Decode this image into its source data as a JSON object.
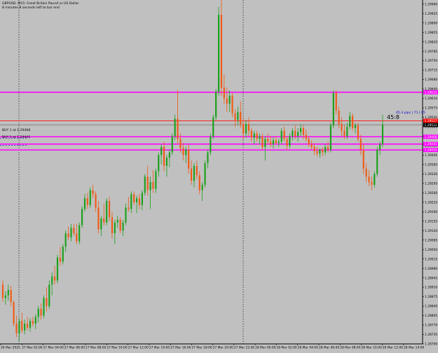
{
  "header": {
    "title_line": "GBPUSD, M15:  Great Britain Pound vs US Dollar",
    "status_line": "8 minutes 8 seconds left to bar end"
  },
  "colors": {
    "background": "#c0c0c0",
    "bull": "#1aa01a",
    "bear": "#f05a14",
    "magenta": "#ff00ff",
    "red_line": "#ff2020",
    "blue_text": "#0000c8",
    "grid": "#000000",
    "current_price_bg": "#ff0000",
    "price_tag_bg": "#000000"
  },
  "price_axis": {
    "labels": [
      "1.29960",
      "1.29925",
      "1.29890",
      "1.29855",
      "1.29820",
      "1.29785",
      "1.29750",
      "1.29715",
      "1.29680",
      "1.29645",
      "1.29610",
      "1.29575",
      "1.29540",
      "1.29505",
      "1.29470",
      "1.29435",
      "1.29400",
      "1.29365",
      "1.29330",
      "1.29295",
      "1.29260",
      "1.29225",
      "1.29190",
      "1.29155",
      "1.29120",
      "1.29085",
      "1.29050",
      "1.29015",
      "1.28980",
      "1.28945",
      "1.28910",
      "1.28875",
      "1.28840",
      "1.28805",
      "1.28770",
      "1.28735",
      "1.28700"
    ],
    "tags": [
      {
        "price": 1.29633,
        "text": "1.29633",
        "bg": "#ff00ff",
        "fg": "#ffffff"
      },
      {
        "price": 1.29527,
        "text": "1.29527",
        "bg": "#ff0000",
        "fg": "#ffffff"
      },
      {
        "price": 1.29512,
        "text": "1.29512",
        "bg": "#000000",
        "fg": "#ffffff"
      },
      {
        "price": 1.29468,
        "text": "1.29468",
        "bg": "#ff00ff",
        "fg": "#ffffff"
      },
      {
        "price": 1.29441,
        "text": "1.29441",
        "bg": "#ff00ff",
        "fg": "#ffffff"
      },
      {
        "price": 1.29419,
        "text": "1.29419",
        "bg": "#ff00ff",
        "fg": "#ffffff"
      }
    ]
  },
  "time_axis": {
    "labels": [
      "26 Mar 2025",
      "27 Mar 02:00",
      "27 Mar 04:00",
      "27 Mar 06:00",
      "27 Mar 08:00",
      "27 Mar 10:00",
      "27 Mar 12:00",
      "27 Mar 14:00",
      "27 Mar 16:00",
      "27 Mar 18:00",
      "27 Mar 20:00",
      "27 Mar 22:00",
      "28 Mar 00:00",
      "28 Mar 02:00",
      "28 Mar 04:00",
      "28 Mar 06:00",
      "28 Mar 08:00",
      "28 Mar 10:00",
      "28 Mar 12:00",
      "28 Mar 14:00"
    ]
  },
  "annotations": {
    "countdown": "45:8",
    "pips_label": "45.3 pips | 71 | 05",
    "buy_line_1": "BUY 1 at 1.29468",
    "buy_line_2": "BUY 1 at 1.29441"
  },
  "levels": {
    "magenta": [
      1.29633,
      1.29468,
      1.29441,
      1.29419
    ],
    "red": [
      1.29527
    ],
    "gray": [
      1.29512
    ]
  },
  "chart_data": {
    "type": "candlestick",
    "symbol": "GBPUSD",
    "timeframe": "M15",
    "ylim": [
      1.287,
      1.29975
    ],
    "grid": false,
    "candles": [
      {
        "o": 1.2892,
        "h": 1.28935,
        "l": 1.28855,
        "c": 1.2887
      },
      {
        "o": 1.2887,
        "h": 1.28895,
        "l": 1.28845,
        "c": 1.2888
      },
      {
        "o": 1.2888,
        "h": 1.2892,
        "l": 1.2886,
        "c": 1.289
      },
      {
        "o": 1.289,
        "h": 1.28915,
        "l": 1.2884,
        "c": 1.28855
      },
      {
        "o": 1.28855,
        "h": 1.2886,
        "l": 1.28765,
        "c": 1.28775
      },
      {
        "o": 1.28775,
        "h": 1.28805,
        "l": 1.28725,
        "c": 1.2874
      },
      {
        "o": 1.2874,
        "h": 1.28795,
        "l": 1.2871,
        "c": 1.28785
      },
      {
        "o": 1.28785,
        "h": 1.28815,
        "l": 1.2874,
        "c": 1.2875
      },
      {
        "o": 1.2875,
        "h": 1.2879,
        "l": 1.28735,
        "c": 1.28775
      },
      {
        "o": 1.28775,
        "h": 1.288,
        "l": 1.2875,
        "c": 1.2876
      },
      {
        "o": 1.2876,
        "h": 1.28795,
        "l": 1.28745,
        "c": 1.28785
      },
      {
        "o": 1.28785,
        "h": 1.288,
        "l": 1.28765,
        "c": 1.28775
      },
      {
        "o": 1.28775,
        "h": 1.2881,
        "l": 1.28755,
        "c": 1.288
      },
      {
        "o": 1.288,
        "h": 1.2884,
        "l": 1.2878,
        "c": 1.2883
      },
      {
        "o": 1.2883,
        "h": 1.2885,
        "l": 1.2879,
        "c": 1.28805
      },
      {
        "o": 1.28805,
        "h": 1.2888,
        "l": 1.28795,
        "c": 1.2887
      },
      {
        "o": 1.2887,
        "h": 1.2891,
        "l": 1.2882,
        "c": 1.2884
      },
      {
        "o": 1.2884,
        "h": 1.28935,
        "l": 1.2883,
        "c": 1.2892
      },
      {
        "o": 1.2892,
        "h": 1.28965,
        "l": 1.2888,
        "c": 1.2895
      },
      {
        "o": 1.2895,
        "h": 1.2899,
        "l": 1.2892,
        "c": 1.28935
      },
      {
        "o": 1.28935,
        "h": 1.2903,
        "l": 1.28925,
        "c": 1.2902
      },
      {
        "o": 1.2902,
        "h": 1.2906,
        "l": 1.2899,
        "c": 1.29005
      },
      {
        "o": 1.29005,
        "h": 1.2907,
        "l": 1.28995,
        "c": 1.2906
      },
      {
        "o": 1.2906,
        "h": 1.2912,
        "l": 1.2904,
        "c": 1.2911
      },
      {
        "o": 1.2911,
        "h": 1.29135,
        "l": 1.29085,
        "c": 1.29095
      },
      {
        "o": 1.29095,
        "h": 1.29145,
        "l": 1.2908,
        "c": 1.2913
      },
      {
        "o": 1.2913,
        "h": 1.29145,
        "l": 1.291,
        "c": 1.2911
      },
      {
        "o": 1.2911,
        "h": 1.29145,
        "l": 1.2907,
        "c": 1.2908
      },
      {
        "o": 1.2908,
        "h": 1.2915,
        "l": 1.2907,
        "c": 1.2914
      },
      {
        "o": 1.2914,
        "h": 1.2921,
        "l": 1.2913,
        "c": 1.292
      },
      {
        "o": 1.292,
        "h": 1.29255,
        "l": 1.2919,
        "c": 1.2924
      },
      {
        "o": 1.2924,
        "h": 1.2926,
        "l": 1.292,
        "c": 1.29215
      },
      {
        "o": 1.29215,
        "h": 1.2928,
        "l": 1.29205,
        "c": 1.2927
      },
      {
        "o": 1.2927,
        "h": 1.2929,
        "l": 1.2924,
        "c": 1.29255
      },
      {
        "o": 1.29255,
        "h": 1.29265,
        "l": 1.2919,
        "c": 1.29205
      },
      {
        "o": 1.29205,
        "h": 1.2923,
        "l": 1.2911,
        "c": 1.29125
      },
      {
        "o": 1.29125,
        "h": 1.29175,
        "l": 1.291,
        "c": 1.29165
      },
      {
        "o": 1.29165,
        "h": 1.2922,
        "l": 1.2914,
        "c": 1.2915
      },
      {
        "o": 1.2915,
        "h": 1.2924,
        "l": 1.2914,
        "c": 1.2923
      },
      {
        "o": 1.2923,
        "h": 1.29245,
        "l": 1.29155,
        "c": 1.2917
      },
      {
        "o": 1.2917,
        "h": 1.2919,
        "l": 1.2909,
        "c": 1.2911
      },
      {
        "o": 1.2911,
        "h": 1.2916,
        "l": 1.2907,
        "c": 1.2915
      },
      {
        "o": 1.2915,
        "h": 1.29175,
        "l": 1.2913,
        "c": 1.2916
      },
      {
        "o": 1.2916,
        "h": 1.2917,
        "l": 1.2911,
        "c": 1.2912
      },
      {
        "o": 1.2912,
        "h": 1.2916,
        "l": 1.291,
        "c": 1.2915
      },
      {
        "o": 1.2915,
        "h": 1.2922,
        "l": 1.2914,
        "c": 1.29205
      },
      {
        "o": 1.29205,
        "h": 1.29245,
        "l": 1.2919,
        "c": 1.292
      },
      {
        "o": 1.292,
        "h": 1.29265,
        "l": 1.29185,
        "c": 1.29255
      },
      {
        "o": 1.29255,
        "h": 1.29265,
        "l": 1.29215,
        "c": 1.29225
      },
      {
        "o": 1.29225,
        "h": 1.2925,
        "l": 1.29185,
        "c": 1.2924
      },
      {
        "o": 1.2924,
        "h": 1.29255,
        "l": 1.292,
        "c": 1.29215
      },
      {
        "o": 1.29215,
        "h": 1.2927,
        "l": 1.29195,
        "c": 1.2926
      },
      {
        "o": 1.2926,
        "h": 1.2933,
        "l": 1.2925,
        "c": 1.2932
      },
      {
        "o": 1.2932,
        "h": 1.2936,
        "l": 1.2925,
        "c": 1.2927
      },
      {
        "o": 1.2927,
        "h": 1.2932,
        "l": 1.292,
        "c": 1.293
      },
      {
        "o": 1.293,
        "h": 1.29345,
        "l": 1.2926,
        "c": 1.29275
      },
      {
        "o": 1.29275,
        "h": 1.2935,
        "l": 1.2926,
        "c": 1.2934
      },
      {
        "o": 1.2934,
        "h": 1.2941,
        "l": 1.2932,
        "c": 1.294
      },
      {
        "o": 1.294,
        "h": 1.2944,
        "l": 1.29365,
        "c": 1.2943
      },
      {
        "o": 1.2943,
        "h": 1.2945,
        "l": 1.2934,
        "c": 1.2936
      },
      {
        "o": 1.2936,
        "h": 1.294,
        "l": 1.2932,
        "c": 1.2939
      },
      {
        "o": 1.2939,
        "h": 1.2942,
        "l": 1.29355,
        "c": 1.2941
      },
      {
        "o": 1.2941,
        "h": 1.2948,
        "l": 1.294,
        "c": 1.2947
      },
      {
        "o": 1.2947,
        "h": 1.2955,
        "l": 1.29455,
        "c": 1.29535
      },
      {
        "o": 1.29535,
        "h": 1.2964,
        "l": 1.2944,
        "c": 1.2946
      },
      {
        "o": 1.2946,
        "h": 1.2948,
        "l": 1.2941,
        "c": 1.29425
      },
      {
        "o": 1.29425,
        "h": 1.29445,
        "l": 1.2938,
        "c": 1.294
      },
      {
        "o": 1.294,
        "h": 1.2943,
        "l": 1.2937,
        "c": 1.2942
      },
      {
        "o": 1.2942,
        "h": 1.2944,
        "l": 1.2933,
        "c": 1.2935
      },
      {
        "o": 1.2935,
        "h": 1.2938,
        "l": 1.2929,
        "c": 1.29305
      },
      {
        "o": 1.29305,
        "h": 1.2937,
        "l": 1.2928,
        "c": 1.2936
      },
      {
        "o": 1.2936,
        "h": 1.2938,
        "l": 1.2931,
        "c": 1.29325
      },
      {
        "o": 1.29325,
        "h": 1.2934,
        "l": 1.29255,
        "c": 1.2927
      },
      {
        "o": 1.2927,
        "h": 1.293,
        "l": 1.2923,
        "c": 1.2929
      },
      {
        "o": 1.2929,
        "h": 1.2938,
        "l": 1.2928,
        "c": 1.2937
      },
      {
        "o": 1.2937,
        "h": 1.2942,
        "l": 1.2935,
        "c": 1.2941
      },
      {
        "o": 1.2941,
        "h": 1.2948,
        "l": 1.294,
        "c": 1.2947
      },
      {
        "o": 1.2947,
        "h": 1.2955,
        "l": 1.2946,
        "c": 1.2954
      },
      {
        "o": 1.2954,
        "h": 1.29645,
        "l": 1.2953,
        "c": 1.29635
      },
      {
        "o": 1.29635,
        "h": 1.2995,
        "l": 1.2962,
        "c": 1.2992
      },
      {
        "o": 1.2992,
        "h": 1.29975,
        "l": 1.2962,
        "c": 1.2965
      },
      {
        "o": 1.2965,
        "h": 1.297,
        "l": 1.2959,
        "c": 1.2961
      },
      {
        "o": 1.2961,
        "h": 1.2965,
        "l": 1.2956,
        "c": 1.2959
      },
      {
        "o": 1.2959,
        "h": 1.2964,
        "l": 1.2956,
        "c": 1.2962
      },
      {
        "o": 1.2962,
        "h": 1.2963,
        "l": 1.2954,
        "c": 1.29555
      },
      {
        "o": 1.29555,
        "h": 1.2957,
        "l": 1.29505,
        "c": 1.2953
      },
      {
        "o": 1.2953,
        "h": 1.2958,
        "l": 1.2951,
        "c": 1.2956
      },
      {
        "o": 1.2956,
        "h": 1.296,
        "l": 1.295,
        "c": 1.29515
      },
      {
        "o": 1.29515,
        "h": 1.29535,
        "l": 1.2946,
        "c": 1.2948
      },
      {
        "o": 1.2948,
        "h": 1.2953,
        "l": 1.29465,
        "c": 1.29515
      },
      {
        "o": 1.29515,
        "h": 1.2954,
        "l": 1.2947,
        "c": 1.2949
      },
      {
        "o": 1.2949,
        "h": 1.295,
        "l": 1.2945,
        "c": 1.29465
      },
      {
        "o": 1.29465,
        "h": 1.2949,
        "l": 1.2944,
        "c": 1.2948
      },
      {
        "o": 1.2948,
        "h": 1.2949,
        "l": 1.2945,
        "c": 1.2946
      },
      {
        "o": 1.2946,
        "h": 1.2948,
        "l": 1.2944,
        "c": 1.2947
      },
      {
        "o": 1.2947,
        "h": 1.2948,
        "l": 1.2942,
        "c": 1.2943
      },
      {
        "o": 1.2943,
        "h": 1.2947,
        "l": 1.2938,
        "c": 1.2946
      },
      {
        "o": 1.2946,
        "h": 1.2948,
        "l": 1.2944,
        "c": 1.2945
      },
      {
        "o": 1.2945,
        "h": 1.2947,
        "l": 1.2943,
        "c": 1.2944
      },
      {
        "o": 1.2944,
        "h": 1.29465,
        "l": 1.29425,
        "c": 1.29455
      },
      {
        "o": 1.29455,
        "h": 1.2947,
        "l": 1.2944,
        "c": 1.29445
      },
      {
        "o": 1.29445,
        "h": 1.2946,
        "l": 1.2943,
        "c": 1.2945
      },
      {
        "o": 1.2945,
        "h": 1.295,
        "l": 1.2944,
        "c": 1.2949
      },
      {
        "o": 1.2949,
        "h": 1.29505,
        "l": 1.2945,
        "c": 1.2946
      },
      {
        "o": 1.2946,
        "h": 1.2947,
        "l": 1.2942,
        "c": 1.29435
      },
      {
        "o": 1.29435,
        "h": 1.2948,
        "l": 1.29425,
        "c": 1.2947
      },
      {
        "o": 1.2947,
        "h": 1.295,
        "l": 1.29455,
        "c": 1.2949
      },
      {
        "o": 1.2949,
        "h": 1.2951,
        "l": 1.2946,
        "c": 1.2947
      },
      {
        "o": 1.2947,
        "h": 1.295,
        "l": 1.2945,
        "c": 1.29485
      },
      {
        "o": 1.29485,
        "h": 1.29515,
        "l": 1.2947,
        "c": 1.295
      },
      {
        "o": 1.295,
        "h": 1.2951,
        "l": 1.2946,
        "c": 1.29475
      },
      {
        "o": 1.29475,
        "h": 1.29495,
        "l": 1.2945,
        "c": 1.2946
      },
      {
        "o": 1.2946,
        "h": 1.2947,
        "l": 1.2943,
        "c": 1.2944
      },
      {
        "o": 1.2944,
        "h": 1.29455,
        "l": 1.2942,
        "c": 1.2943
      },
      {
        "o": 1.2943,
        "h": 1.29445,
        "l": 1.294,
        "c": 1.29415
      },
      {
        "o": 1.29415,
        "h": 1.2943,
        "l": 1.29395,
        "c": 1.29405
      },
      {
        "o": 1.29405,
        "h": 1.29425,
        "l": 1.2939,
        "c": 1.2942
      },
      {
        "o": 1.2942,
        "h": 1.2943,
        "l": 1.29395,
        "c": 1.2941
      },
      {
        "o": 1.2941,
        "h": 1.2944,
        "l": 1.294,
        "c": 1.2943
      },
      {
        "o": 1.2943,
        "h": 1.2945,
        "l": 1.2941,
        "c": 1.2942
      },
      {
        "o": 1.2942,
        "h": 1.2952,
        "l": 1.2941,
        "c": 1.2951
      },
      {
        "o": 1.2951,
        "h": 1.2964,
        "l": 1.295,
        "c": 1.2963
      },
      {
        "o": 1.2963,
        "h": 1.2964,
        "l": 1.2955,
        "c": 1.29565
      },
      {
        "o": 1.29565,
        "h": 1.2958,
        "l": 1.295,
        "c": 1.29515
      },
      {
        "o": 1.29515,
        "h": 1.2954,
        "l": 1.2947,
        "c": 1.2949
      },
      {
        "o": 1.2949,
        "h": 1.2951,
        "l": 1.2946,
        "c": 1.2947
      },
      {
        "o": 1.2947,
        "h": 1.2952,
        "l": 1.2946,
        "c": 1.29505
      },
      {
        "o": 1.29505,
        "h": 1.2956,
        "l": 1.29495,
        "c": 1.29545
      },
      {
        "o": 1.29545,
        "h": 1.29555,
        "l": 1.2949,
        "c": 1.295
      },
      {
        "o": 1.295,
        "h": 1.2952,
        "l": 1.2948,
        "c": 1.2951
      },
      {
        "o": 1.2951,
        "h": 1.2952,
        "l": 1.2945,
        "c": 1.2946
      },
      {
        "o": 1.2946,
        "h": 1.29475,
        "l": 1.294,
        "c": 1.2942
      },
      {
        "o": 1.2942,
        "h": 1.2944,
        "l": 1.2933,
        "c": 1.2935
      },
      {
        "o": 1.2935,
        "h": 1.2937,
        "l": 1.293,
        "c": 1.2932
      },
      {
        "o": 1.2932,
        "h": 1.29345,
        "l": 1.29285,
        "c": 1.293
      },
      {
        "o": 1.293,
        "h": 1.2932,
        "l": 1.2927,
        "c": 1.2929
      },
      {
        "o": 1.2929,
        "h": 1.2934,
        "l": 1.2928,
        "c": 1.2933
      },
      {
        "o": 1.2933,
        "h": 1.2943,
        "l": 1.2932,
        "c": 1.2942
      },
      {
        "o": 1.2942,
        "h": 1.2945,
        "l": 1.294,
        "c": 1.2944
      },
      {
        "o": 1.2944,
        "h": 1.2955,
        "l": 1.2943,
        "c": 1.29512
      }
    ]
  }
}
